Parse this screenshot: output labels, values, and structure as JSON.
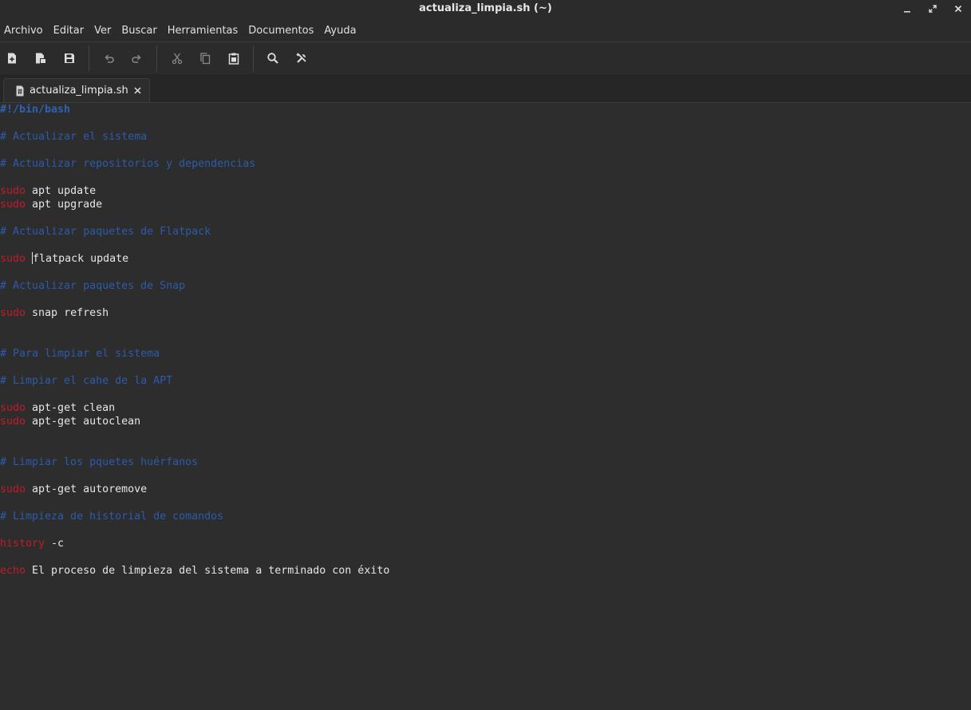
{
  "window": {
    "title": "actualiza_limpia.sh (~)"
  },
  "menubar": {
    "items": [
      "Archivo",
      "Editar",
      "Ver",
      "Buscar",
      "Herramientas",
      "Documentos",
      "Ayuda"
    ]
  },
  "toolbar": {
    "buttons": [
      {
        "name": "new-document",
        "icon": "new-file-icon"
      },
      {
        "name": "open-document",
        "icon": "open-file-icon"
      },
      {
        "name": "save-document",
        "icon": "save-icon"
      },
      {
        "name": "undo",
        "icon": "undo-icon"
      },
      {
        "name": "redo",
        "icon": "redo-icon"
      },
      {
        "name": "cut",
        "icon": "cut-icon"
      },
      {
        "name": "copy",
        "icon": "copy-icon"
      },
      {
        "name": "paste",
        "icon": "paste-icon"
      },
      {
        "name": "find",
        "icon": "search-icon"
      },
      {
        "name": "tools",
        "icon": "tools-icon"
      }
    ]
  },
  "tabs": [
    {
      "label": "actualiza_limpia.sh",
      "active": true
    }
  ],
  "editor": {
    "lines": [
      {
        "row": 0,
        "parts": [
          {
            "t": "#!/bin/bash",
            "c": "sh"
          }
        ]
      },
      {
        "row": 2,
        "parts": [
          {
            "t": "# Actualizar el sistema",
            "c": "cm"
          }
        ]
      },
      {
        "row": 4,
        "parts": [
          {
            "t": "# Actualizar repositorios y dependencias",
            "c": "cm"
          }
        ]
      },
      {
        "row": 6,
        "parts": [
          {
            "t": "sudo",
            "c": "kw"
          },
          {
            "t": " apt update",
            "c": "txt"
          }
        ]
      },
      {
        "row": 7,
        "parts": [
          {
            "t": "sudo",
            "c": "kw"
          },
          {
            "t": " apt upgrade",
            "c": "txt"
          }
        ]
      },
      {
        "row": 9,
        "parts": [
          {
            "t": "# Actualizar paquetes de Flatpack",
            "c": "cm"
          }
        ]
      },
      {
        "row": 11,
        "parts": [
          {
            "t": "sudo",
            "c": "kw"
          },
          {
            "t": " ",
            "c": "txt"
          },
          {
            "t": "",
            "c": "cursor"
          },
          {
            "t": "flatpack update",
            "c": "txt"
          }
        ]
      },
      {
        "row": 13,
        "parts": [
          {
            "t": "# Actualizar paquetes de Snap",
            "c": "cm"
          }
        ]
      },
      {
        "row": 15,
        "parts": [
          {
            "t": "sudo",
            "c": "kw"
          },
          {
            "t": " snap refresh",
            "c": "txt"
          }
        ]
      },
      {
        "row": 18,
        "parts": [
          {
            "t": "# Para limpiar el sistema",
            "c": "cm"
          }
        ]
      },
      {
        "row": 20,
        "parts": [
          {
            "t": "# Limpiar el cahe de la APT",
            "c": "cm"
          }
        ]
      },
      {
        "row": 22,
        "parts": [
          {
            "t": "sudo",
            "c": "kw"
          },
          {
            "t": " apt-get clean",
            "c": "txt"
          }
        ]
      },
      {
        "row": 23,
        "parts": [
          {
            "t": "sudo",
            "c": "kw"
          },
          {
            "t": " apt-get autoclean",
            "c": "txt"
          }
        ]
      },
      {
        "row": 26,
        "parts": [
          {
            "t": "# Limpiar los pquetes huérfanos",
            "c": "cm"
          }
        ]
      },
      {
        "row": 28,
        "parts": [
          {
            "t": "sudo",
            "c": "kw"
          },
          {
            "t": " apt-get autoremove",
            "c": "txt"
          }
        ]
      },
      {
        "row": 30,
        "parts": [
          {
            "t": "# Limpieza de historial de comandos",
            "c": "cm"
          }
        ]
      },
      {
        "row": 32,
        "parts": [
          {
            "t": "history",
            "c": "kw"
          },
          {
            "t": " -c",
            "c": "txt"
          }
        ]
      },
      {
        "row": 34,
        "parts": [
          {
            "t": "echo",
            "c": "kw"
          },
          {
            "t": " El proceso de limpieza del sistema a terminado con éxito",
            "c": "txt"
          }
        ]
      }
    ]
  },
  "colors": {
    "keyword": "#c01c28",
    "comment": "#2c5bab",
    "background": "#2d2d2d"
  }
}
